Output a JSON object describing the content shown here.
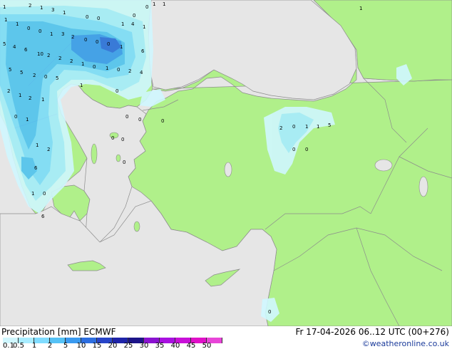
{
  "legend": {
    "title": "Precipitation [mm]",
    "model": "ECMWF",
    "valid_time": "Fr 17-04-2026 06..12 UTC (00+276)",
    "credit": "©weatheronline.co.uk",
    "ticks": [
      "0.1",
      "0.5",
      "1",
      "2",
      "5",
      "10",
      "15",
      "20",
      "25",
      "30",
      "35",
      "40",
      "45",
      "50"
    ],
    "colors": [
      "#d0f7ff",
      "#a8ecff",
      "#80dcff",
      "#55c2f6",
      "#3a9af0",
      "#2d6ee0",
      "#2844c8",
      "#1f24a8",
      "#1c1488",
      "#8a12d0",
      "#a810e0",
      "#c810d8",
      "#e010c8",
      "#e845d8"
    ]
  },
  "map_colors": {
    "sea": "#e6e6e6",
    "land": "#b0f08a",
    "border": "#8c8c8c"
  },
  "values": [
    "2",
    "1",
    "3",
    "1",
    "0",
    "0",
    "1",
    "1",
    "0",
    "0",
    "1",
    "3",
    "2",
    "0",
    "0",
    "0",
    "1",
    "4",
    "1",
    "5",
    "4",
    "6",
    "10",
    "2",
    "2",
    "2",
    "1",
    "0",
    "1",
    "0",
    "2",
    "4",
    "6",
    "5",
    "5",
    "2",
    "0",
    "5",
    "2",
    "1",
    "2",
    "1",
    "0",
    "1",
    "1",
    "2",
    "6",
    "0",
    "1",
    "1",
    "0",
    "1",
    "0",
    "0",
    "0",
    "0",
    "0",
    "0",
    "0",
    "2",
    "0",
    "1",
    "1",
    "5",
    "0",
    "0",
    "1",
    "0",
    "6",
    "1",
    "0",
    "1",
    "1"
  ]
}
